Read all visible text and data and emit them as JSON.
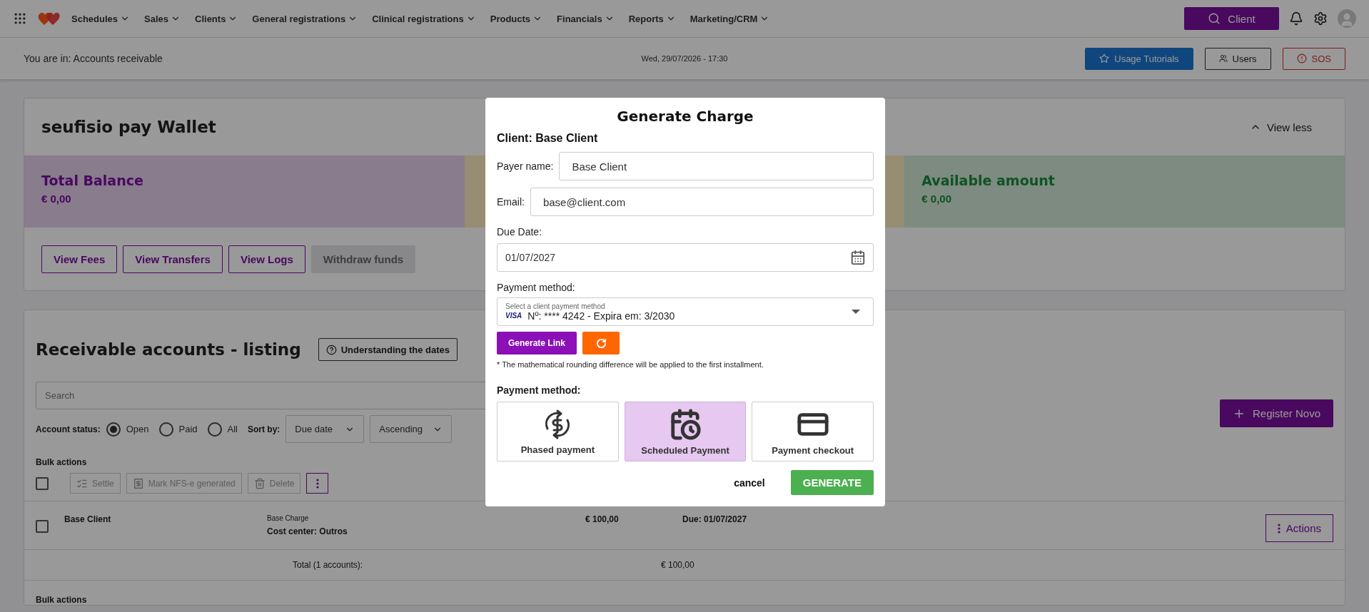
{
  "nav": {
    "items": [
      "Schedules",
      "Sales",
      "Clients",
      "General registrations",
      "Clinical registrations",
      "Products",
      "Financials",
      "Reports",
      "Marketing/CRM"
    ],
    "search_button": "Client"
  },
  "breadcrumb": "You are in: Accounts receivable",
  "datetime": "Wed, 29/07/2026 - 17:30",
  "header_buttons": [
    {
      "label": "Usage Tutorials",
      "kind": "tutorials"
    },
    {
      "label": "Users",
      "kind": "users"
    },
    {
      "label": "SOS",
      "kind": "sos"
    }
  ],
  "wallet": {
    "title": "seufisio pay Wallet",
    "toggle": "View less",
    "balances": [
      {
        "label": "Total Balance",
        "amount": "€ 0,00",
        "kind": "total"
      },
      {
        "label": "Available amount",
        "amount": "€ 0,00",
        "kind": "available"
      }
    ],
    "actions": [
      {
        "label": "View Fees",
        "disabled": false
      },
      {
        "label": "View Transfers",
        "disabled": false
      },
      {
        "label": "View Logs",
        "disabled": false
      },
      {
        "label": "Withdraw funds",
        "disabled": true
      }
    ]
  },
  "listing": {
    "title": "Receivable accounts - listing",
    "help_button": "Understanding the dates",
    "search": {
      "placeholder": "Search"
    },
    "register_button": "Register Novo",
    "status_label": "Account status:",
    "status_options": [
      {
        "label": "Open",
        "selected": true
      },
      {
        "label": "Paid",
        "selected": false
      },
      {
        "label": "All",
        "selected": false
      }
    ],
    "sort_label": "Sort by:",
    "sort_field": "Due date",
    "sort_order": "Ascending",
    "bulk_label": "Bulk actions",
    "select_all_checked": false,
    "bulk_buttons": [
      {
        "label": "Settle",
        "kind": "settle",
        "disabled": true
      },
      {
        "label": "Mark NFS-e generated",
        "kind": "nfse",
        "disabled": true
      },
      {
        "label": "Delete",
        "kind": "delete",
        "disabled": true
      }
    ],
    "rows": [
      {
        "checked": false,
        "client": "Base Client",
        "description": "Base Charge",
        "cost_center": "Cost center: Outros",
        "amount": "€ 100,00",
        "due": "Due: 01/07/2027",
        "actions": "Actions"
      }
    ],
    "total_label": "Total (1 accounts):",
    "total_amount": "€ 100,00",
    "bottom_bulk_label": "Bulk actions"
  },
  "modal": {
    "title": "Generate Charge",
    "client": "Client: Base Client",
    "payer_label": "Payer name:",
    "payer_value": "Base Client",
    "email_label": "Email:",
    "email_value": "base@client.com",
    "due_label": "Due Date:",
    "due_value": "01/07/2027",
    "method_label": "Payment method:",
    "method_hint": "Select a client payment method",
    "card_brand": "VISA",
    "method_value": "Nº: **** 4242 - Expira em: 3/2030",
    "generate_link": "Generate Link",
    "note": "* The mathematical rounding difference will be applied to the first installment.",
    "choice_label": "Payment method:",
    "choices": [
      {
        "label": "Phased payment",
        "kind": "phased",
        "selected": false
      },
      {
        "label": "Scheduled Payment",
        "kind": "scheduled",
        "selected": true
      },
      {
        "label": "Payment checkout",
        "kind": "checkout",
        "selected": false
      }
    ],
    "cancel": "cancel",
    "generate": "GENERATE"
  }
}
